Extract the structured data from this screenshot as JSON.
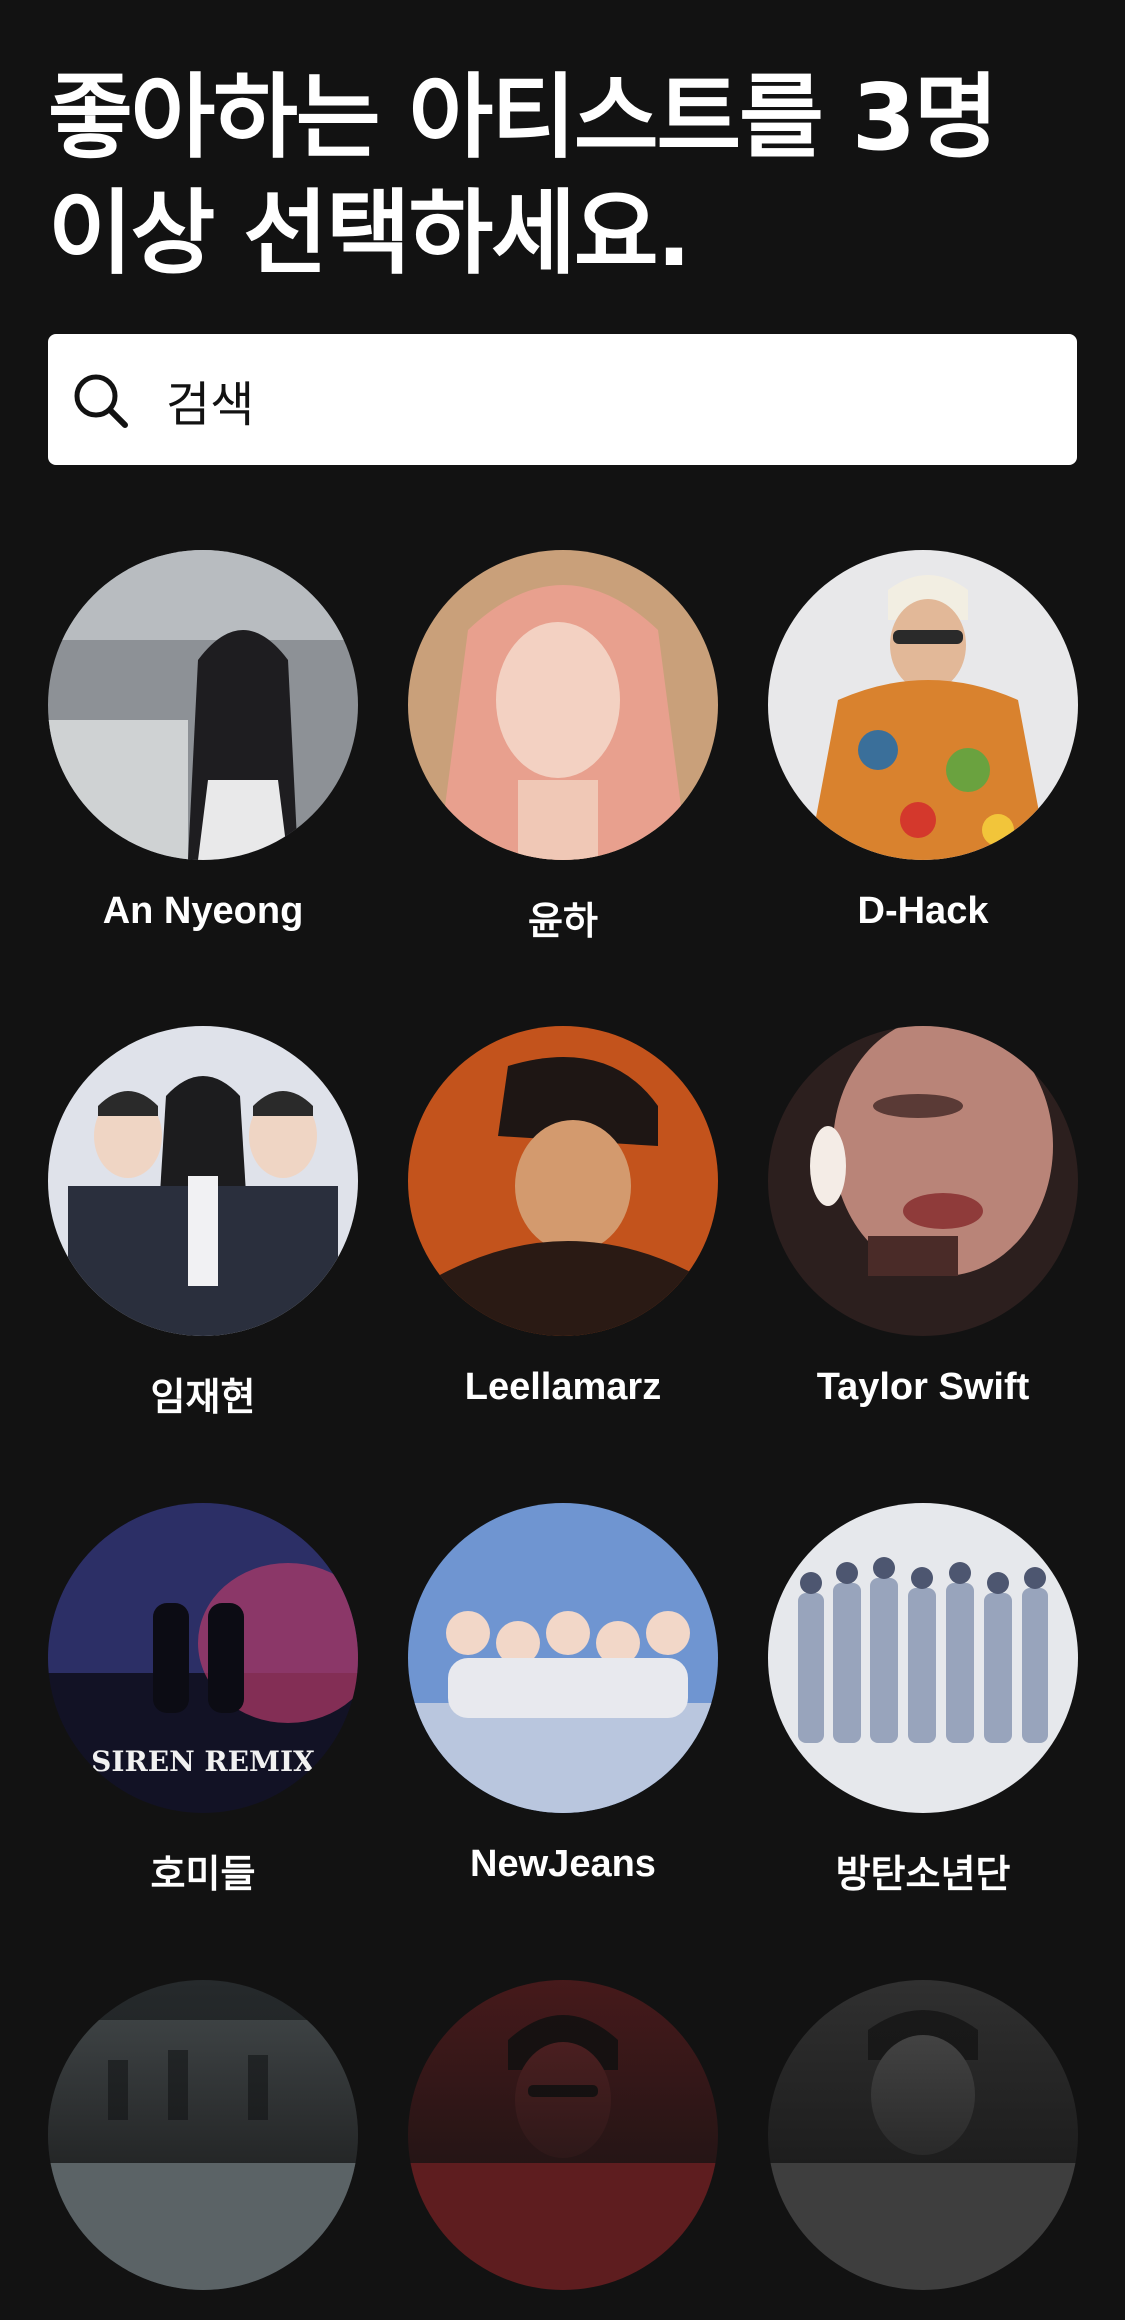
{
  "header": {
    "title": "좋아하는 아티스트를 3명 이상 선택하세요."
  },
  "search": {
    "placeholder": "검색",
    "icon": "search-icon"
  },
  "artists": [
    {
      "name": "An Nyeong",
      "palette": [
        "#8d9196",
        "#cfd2d3",
        "#2b2a2c"
      ]
    },
    {
      "name": "윤하",
      "palette": [
        "#c9a07a",
        "#e8a08e",
        "#6b4a33"
      ]
    },
    {
      "name": "D-Hack",
      "palette": [
        "#e8e8ea",
        "#d9822e",
        "#3a6f9a"
      ]
    },
    {
      "name": "임재현",
      "palette": [
        "#c8ccd6",
        "#2a2f3d",
        "#f1f1f3"
      ]
    },
    {
      "name": "Leellamarz",
      "palette": [
        "#c3531c",
        "#2a1a14",
        "#e07a2c"
      ]
    },
    {
      "name": "Taylor Swift",
      "palette": [
        "#5a3a36",
        "#b98478",
        "#2c1f1e"
      ]
    },
    {
      "name": "호미들",
      "palette": [
        "#2c2f66",
        "#b33a6a",
        "#121225"
      ]
    },
    {
      "name": "NewJeans",
      "palette": [
        "#6f95d1",
        "#c9d3e6",
        "#2e4470"
      ]
    },
    {
      "name": "방탄소년단",
      "palette": [
        "#e6e8ec",
        "#98a4bc",
        "#4d5670"
      ]
    },
    {
      "name": "",
      "palette": [
        "#5b6366",
        "#2f3538",
        "#8d9497"
      ]
    },
    {
      "name": "",
      "palette": [
        "#5e1d1f",
        "#2a1212",
        "#7b2a2c"
      ]
    },
    {
      "name": "",
      "palette": [
        "#3e3e3e",
        "#1e1e1e",
        "#6a6a6a"
      ]
    }
  ]
}
